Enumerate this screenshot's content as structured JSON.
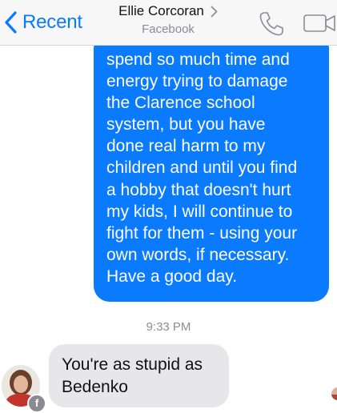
{
  "nav": {
    "back_label": "Recent",
    "contact_name": "Ellie Corcoran",
    "subtitle": "Facebook",
    "icons": [
      "chevron-left-icon",
      "chevron-right-icon",
      "phone-icon",
      "video-camera-icon"
    ],
    "accent_color": "#0a7aff"
  },
  "conversation": {
    "outgoing_message": {
      "lines": [
        "spend so much time and",
        "energy trying to damage",
        "the Clarence school",
        "system, but you have",
        "done real harm to my",
        "children and until you find",
        "a hobby that doesn't hurt",
        "my kids, I will continue to",
        "fight for them - using your",
        "own words, if necessary.",
        "Have a good day."
      ],
      "bubble_color": "#0a7aff"
    },
    "timestamp": "9:33 PM",
    "incoming_message": {
      "lines": [
        "You're as stupid as",
        "Bedenko"
      ],
      "bubble_color": "#e7e7ea"
    },
    "avatar_badge": "f"
  }
}
